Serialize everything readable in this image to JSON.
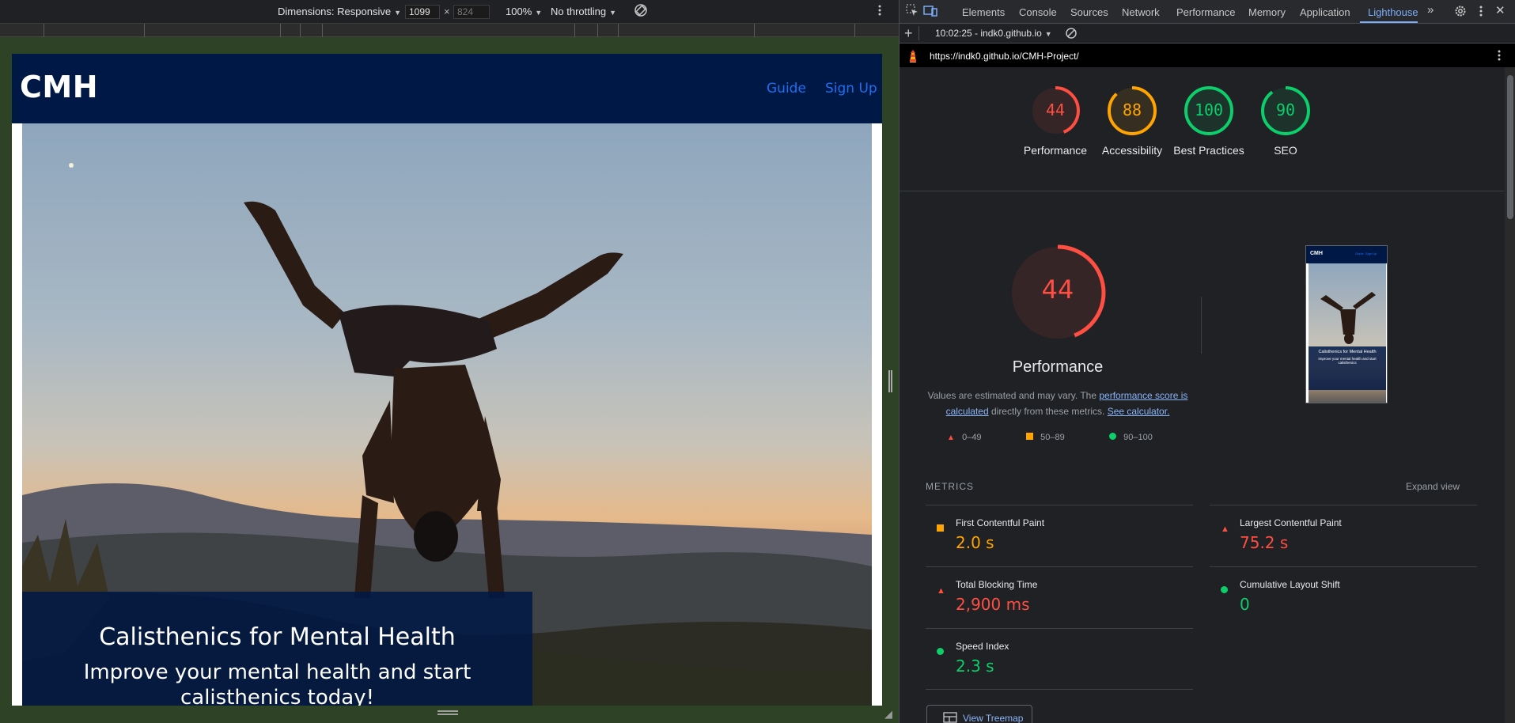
{
  "device_toolbar": {
    "dimensions_label": "Dimensions: Responsive",
    "width_value": "1099",
    "times": "×",
    "height_value": "824",
    "zoom": "100%",
    "throttling": "No throttling"
  },
  "site": {
    "logo": "CMH",
    "nav": [
      "Guide",
      "Sign Up"
    ],
    "hero_title": "Calisthenics for Mental Health",
    "hero_subtitle": "Improve your mental health and start calisthenics today!"
  },
  "devtools": {
    "tabs": [
      "Elements",
      "Console",
      "Sources",
      "Network",
      "Performance",
      "Memory",
      "Application",
      "Lighthouse"
    ],
    "active_tab": "Lighthouse",
    "report_selector": "10:02:25 - indk0.github.io",
    "url": "https://indk0.github.io/CMH-Project/"
  },
  "scores": [
    {
      "label": "Performance",
      "value": 44,
      "color": "#ff4e42",
      "fraction": 0.44
    },
    {
      "label": "Accessibility",
      "value": 88,
      "color": "#ffa400",
      "fraction": 0.88
    },
    {
      "label": "Best Practices",
      "value": 100,
      "color": "#0cce6b",
      "fraction": 1.0
    },
    {
      "label": "SEO",
      "value": 90,
      "color": "#0cce6b",
      "fraction": 0.9
    }
  ],
  "performance": {
    "title": "Performance",
    "score": 44,
    "desc_prefix": "Values are estimated and may vary. The ",
    "link1": "performance score is calculated",
    "desc_mid": " directly from these metrics. ",
    "link2": "See calculator.",
    "legend": [
      "0–49",
      "50–89",
      "90–100"
    ]
  },
  "metrics": {
    "heading": "METRICS",
    "expand": "Expand view",
    "items": [
      {
        "label": "First Contentful Paint",
        "value": "2.0 s",
        "status": "average",
        "color": "#ffa400"
      },
      {
        "label": "Largest Contentful Paint",
        "value": "75.2 s",
        "status": "fail",
        "color": "#ff4e42"
      },
      {
        "label": "Total Blocking Time",
        "value": "2,900 ms",
        "status": "fail",
        "color": "#ff4e42"
      },
      {
        "label": "Cumulative Layout Shift",
        "value": "0",
        "status": "pass",
        "color": "#0cce6b"
      },
      {
        "label": "Speed Index",
        "value": "2.3 s",
        "status": "pass",
        "color": "#0cce6b"
      }
    ],
    "treemap_button": "View Treemap"
  },
  "thumbnail": {
    "logo": "CMH",
    "nav": "Guide  Sign Up",
    "title": "Calisthenics for Mental Health",
    "subtitle": "Improve your mental health and start calisthenics"
  }
}
